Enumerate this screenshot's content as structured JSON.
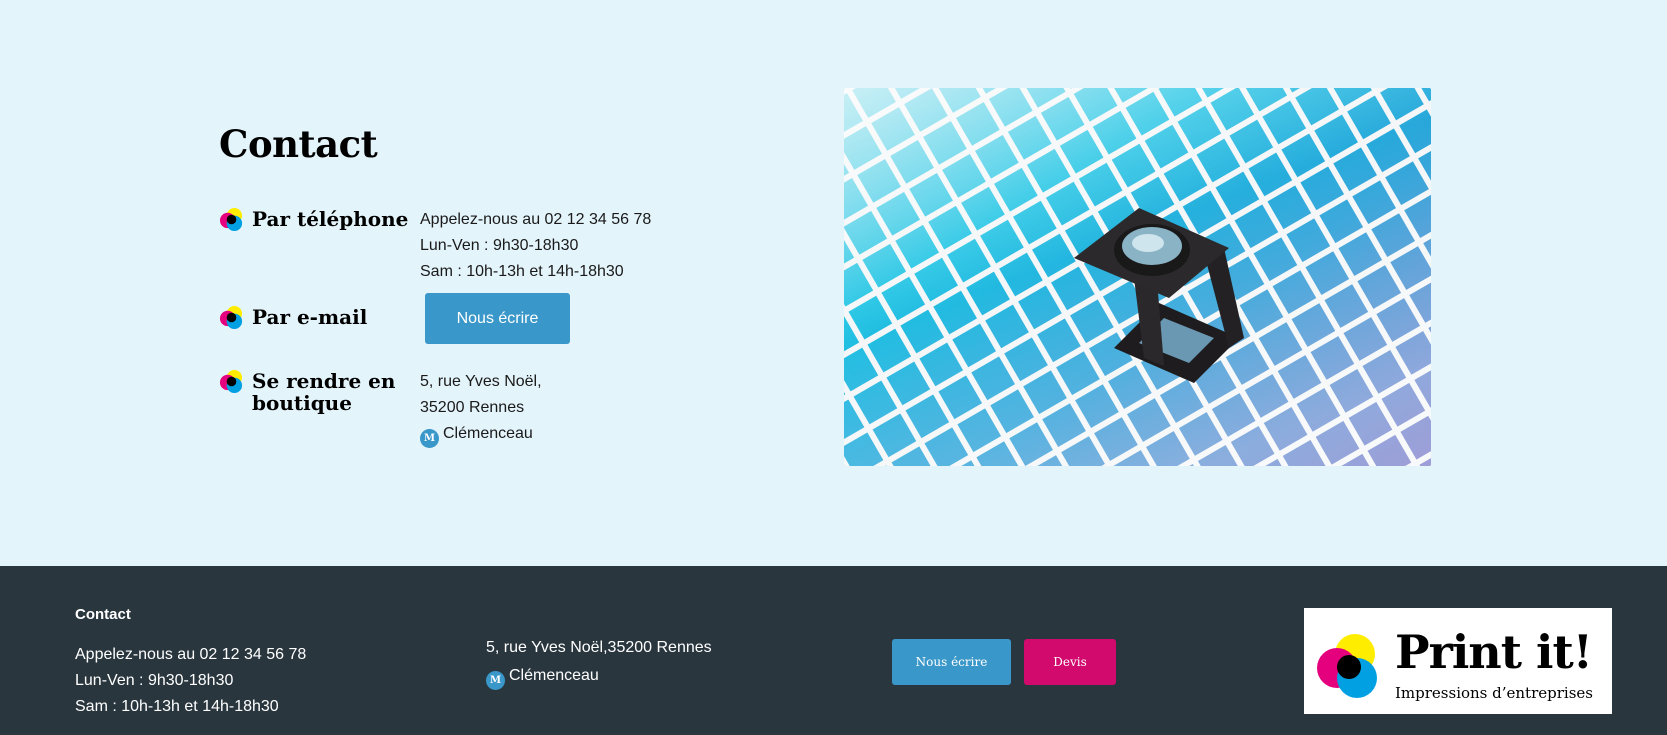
{
  "contact": {
    "title": "Contact",
    "phone": {
      "label": "Par téléphone",
      "lines": [
        "Appelez-nous au 02 12 34 56 78",
        "Lun-Ven : 9h30-18h30",
        "Sam : 10h-13h et 14h-18h30"
      ]
    },
    "email": {
      "label": "Par e-mail",
      "button": "Nous écrire"
    },
    "store": {
      "label_line1": "Se rendre en",
      "label_line2": "boutique",
      "address1": "5, rue Yves Noël,",
      "address2": "35200 Rennes",
      "metro_badge": "M",
      "metro_station": "Clémenceau"
    }
  },
  "footer": {
    "title": "Contact",
    "phone_lines": [
      "Appelez-nous au 02 12 34 56 78",
      "Lun-Ven : 9h30-18h30",
      "Sam : 10h-13h et 14h-18h30"
    ],
    "address": "5, rue Yves Noël,35200 Rennes",
    "metro_badge": "M",
    "metro_station": "Clémenceau",
    "write_button": "Nous écrire",
    "quote_button": "Devis"
  },
  "logo": {
    "name": "Print it!",
    "tagline": "Impressions d’entreprises"
  },
  "colors": {
    "background": "#e4f4fb",
    "accent_blue": "#3a97c9",
    "accent_magenta": "#d20a6e",
    "footer_bg": "#29363e",
    "cmy_cyan": "#00a0e3",
    "cmy_magenta": "#e5007e",
    "cmy_yellow": "#ffed00"
  },
  "icons": {
    "section_bullet": "cmy-circles-icon",
    "metro": "metro-icon",
    "hero_image": "loupe-on-color-swatches-image"
  }
}
